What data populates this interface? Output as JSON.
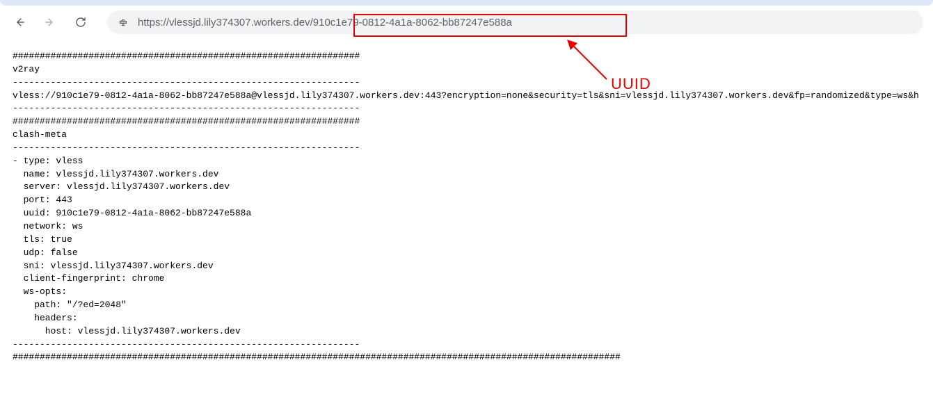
{
  "url": "https://vlessjd.lily374307.workers.dev/910c1e79-0812-4a1a-8062-bb87247e588a",
  "annotation": {
    "label": "UUID",
    "highlighted_segment": "/910c1e79-0812-4a1a-8062-bb87247e588a"
  },
  "page_text": {
    "hash_line_1": "################################################################",
    "v2ray_header": "v2ray",
    "dash_line_1": "----------------------------------------------------------------",
    "vless_uri": "vless://910c1e79-0812-4a1a-8062-bb87247e588a@vlessjd.lily374307.workers.dev:443?encryption=none&security=tls&sni=vlessjd.lily374307.workers.dev&fp=randomized&type=ws&h",
    "dash_line_2": "----------------------------------------------------------------",
    "hash_line_2": "################################################################",
    "clash_header": "clash-meta",
    "dash_line_3": "----------------------------------------------------------------",
    "clash_type": "- type: vless",
    "clash_name": "  name: vlessjd.lily374307.workers.dev",
    "clash_server": "  server: vlessjd.lily374307.workers.dev",
    "clash_port": "  port: 443",
    "clash_uuid": "  uuid: 910c1e79-0812-4a1a-8062-bb87247e588a",
    "clash_network": "  network: ws",
    "clash_tls": "  tls: true",
    "clash_udp": "  udp: false",
    "clash_sni": "  sni: vlessjd.lily374307.workers.dev",
    "clash_fp": "  client-fingerprint: chrome",
    "clash_wsopts": "  ws-opts:",
    "clash_path": "    path: \"/?ed=2048\"",
    "clash_headers": "    headers:",
    "clash_host": "      host: vlessjd.lily374307.workers.dev",
    "dash_line_4": "----------------------------------------------------------------",
    "hash_line_3": "################################################################################################################"
  }
}
